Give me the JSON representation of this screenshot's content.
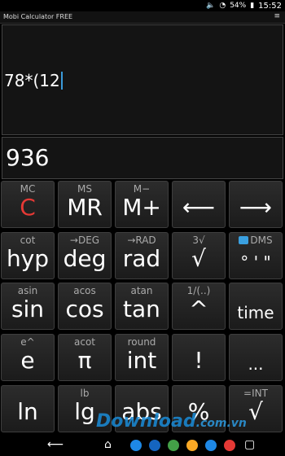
{
  "status": {
    "battery": "54%",
    "time": "15:52"
  },
  "app": {
    "title": "Mobi Calculator FREE",
    "menu_icon": "menu-icon"
  },
  "display": {
    "expression": "78*(12",
    "result": "936"
  },
  "keys": [
    {
      "sub": "MC",
      "main": "C",
      "name": "clear-key"
    },
    {
      "sub": "MS",
      "main": "MR",
      "name": "memory-recall-key"
    },
    {
      "sub": "M−",
      "main": "M+",
      "name": "memory-add-key"
    },
    {
      "sub": "",
      "main": "⟵",
      "name": "backspace-key"
    },
    {
      "sub": "",
      "main": "⟶",
      "name": "forward-key"
    },
    {
      "sub": "cot",
      "main": "hyp",
      "name": "hyp-key"
    },
    {
      "sub": "→DEG",
      "main": "deg",
      "name": "deg-key"
    },
    {
      "sub": "→RAD",
      "main": "rad",
      "name": "rad-key"
    },
    {
      "sub": "3√",
      "main": "√",
      "name": "sqrt-key"
    },
    {
      "sub": "DMS",
      "main": "° ' \"",
      "name": "dms-key"
    },
    {
      "sub": "asin",
      "main": "sin",
      "name": "sin-key"
    },
    {
      "sub": "acos",
      "main": "cos",
      "name": "cos-key"
    },
    {
      "sub": "atan",
      "main": "tan",
      "name": "tan-key"
    },
    {
      "sub": "1/(..)",
      "main": "^",
      "name": "power-key"
    },
    {
      "sub": "",
      "main": "time",
      "name": "time-key"
    },
    {
      "sub": "e^",
      "main": "e",
      "name": "e-key"
    },
    {
      "sub": "acot",
      "main": "π",
      "name": "pi-key"
    },
    {
      "sub": "round",
      "main": "int",
      "name": "int-key"
    },
    {
      "sub": "",
      "main": "!",
      "name": "factorial-key"
    },
    {
      "sub": "",
      "main": "...",
      "name": "more-key"
    },
    {
      "sub": "",
      "main": "ln",
      "name": "ln-key"
    },
    {
      "sub": "lb",
      "main": "lg",
      "name": "lg-key"
    },
    {
      "sub": "",
      "main": "abs",
      "name": "abs-key"
    },
    {
      "sub": "",
      "main": "%",
      "name": "percent-key"
    },
    {
      "sub": "=INT",
      "main": "√",
      "name": "sqrt2-key"
    }
  ],
  "watermark": {
    "text": "Download",
    "suffix": ".com.vn"
  },
  "colors": {
    "accent": "#3a9ad9",
    "clear": "#e53935"
  }
}
